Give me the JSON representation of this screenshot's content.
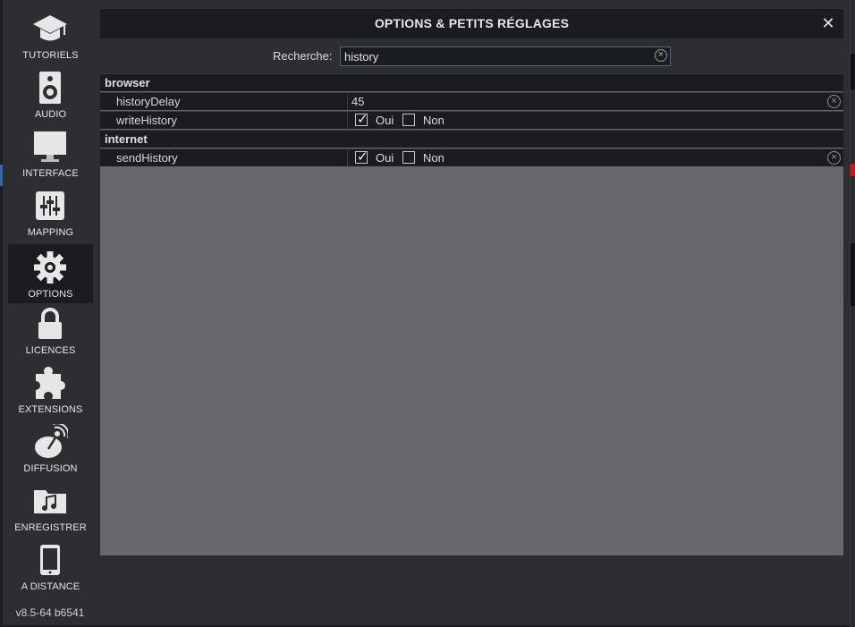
{
  "dialog": {
    "title": "OPTIONS & PETITS RÉGLAGES"
  },
  "sidebar": {
    "items": [
      {
        "label": "TUTORIELS",
        "icon": "graduation-cap-icon"
      },
      {
        "label": "AUDIO",
        "icon": "speaker-icon"
      },
      {
        "label": "INTERFACE",
        "icon": "monitor-icon"
      },
      {
        "label": "MAPPING",
        "icon": "sliders-icon"
      },
      {
        "label": "OPTIONS",
        "icon": "gear-icon",
        "active": true
      },
      {
        "label": "LICENCES",
        "icon": "lock-icon"
      },
      {
        "label": "EXTENSIONS",
        "icon": "puzzle-icon"
      },
      {
        "label": "DIFFUSION",
        "icon": "broadcast-icon"
      },
      {
        "label": "ENREGISTRER",
        "icon": "music-folder-icon"
      },
      {
        "label": "A DISTANCE",
        "icon": "phone-icon"
      }
    ],
    "version": "v8.5-64 b6541"
  },
  "search": {
    "label": "Recherche:",
    "value": "history"
  },
  "options": {
    "groups": [
      {
        "name": "browser",
        "rows": [
          {
            "key": "historyDelay",
            "value": "45"
          },
          {
            "key": "writeHistory",
            "yes_label": "Oui",
            "no_label": "Non",
            "checked": "Oui"
          }
        ]
      },
      {
        "name": "internet",
        "rows": [
          {
            "key": "sendHistory",
            "yes_label": "Oui",
            "no_label": "Non",
            "checked": "Oui"
          }
        ]
      }
    ]
  },
  "colors": {
    "accent": "#4a6c8c",
    "panel": "#68686c",
    "row": "#1b1c1f"
  }
}
